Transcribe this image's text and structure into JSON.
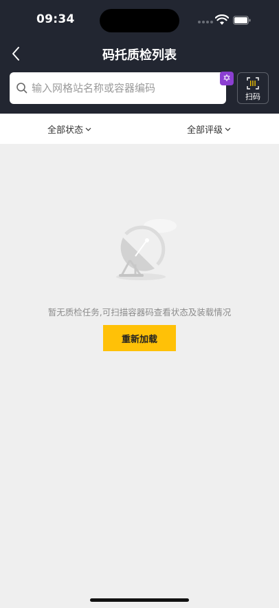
{
  "status_bar": {
    "time": "09:34"
  },
  "header": {
    "title": "码托质检列表",
    "back_icon": "chevron-left-icon"
  },
  "search": {
    "placeholder": "输入网格站名称或容器编码",
    "value": ""
  },
  "scan": {
    "label": "扫码",
    "icon": "barcode-scan-icon"
  },
  "filters": {
    "status_label": "全部状态",
    "grade_label": "全部评级"
  },
  "empty_state": {
    "message": "暂无质检任务,可扫描容器码查看状态及装载情况",
    "reload_label": "重新加载",
    "icon": "satellite-dish-icon"
  },
  "colors": {
    "header_bg": "#222631",
    "accent": "#ffc107",
    "page_bg": "#efefef"
  }
}
